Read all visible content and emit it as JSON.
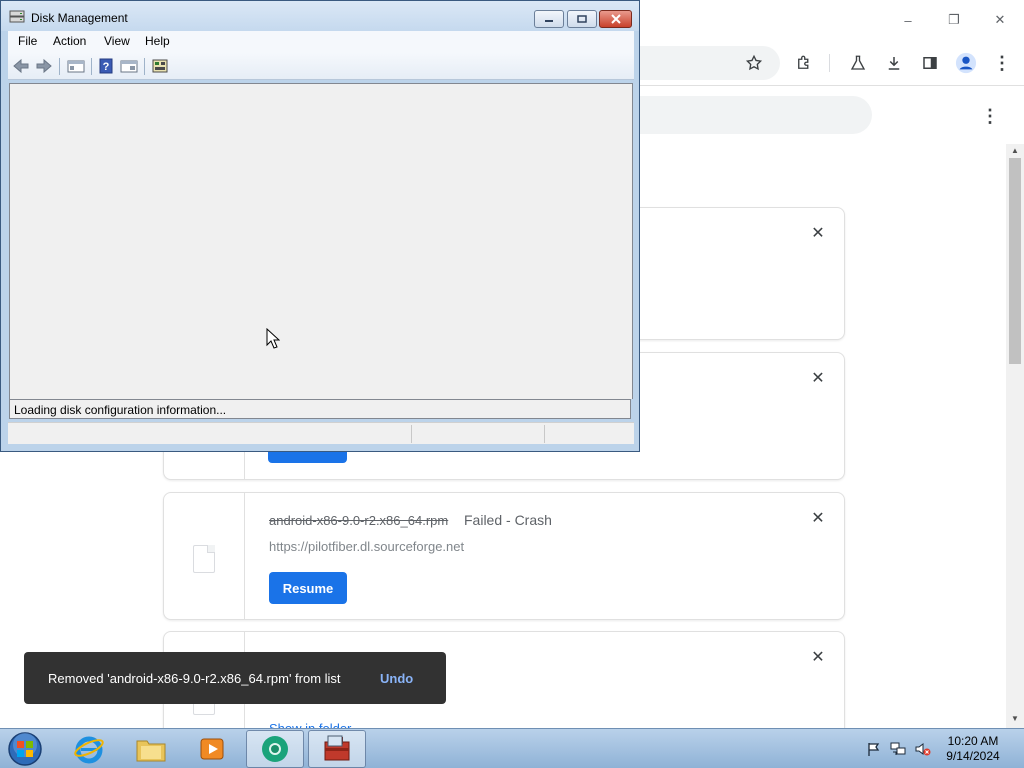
{
  "browser": {
    "window_controls": {
      "minimize": "–",
      "restore": "❐",
      "close": "✕"
    },
    "toolbar_icons": [
      "star-icon",
      "extensions-icon",
      "labs-icon",
      "download-icon",
      "side-panel-icon",
      "profile-icon",
      "menu-icon"
    ],
    "downloads": [
      {
        "file_name": "",
        "status": "",
        "url": "",
        "action": ""
      },
      {
        "file_name": "",
        "status": "",
        "url": "",
        "action": "Resume"
      },
      {
        "file_name": "android-x86-9.0-r2.x86_64.rpm",
        "status": "Failed - Crash",
        "url": "https://pilotfiber.dl.sourceforge.net",
        "action": "Resume"
      },
      {
        "file_name": "",
        "status": "",
        "url": "",
        "action": "Show in folder"
      }
    ],
    "toast": {
      "message": "Removed 'android-x86-9.0-r2.x86_64.rpm' from list",
      "undo": "Undo"
    }
  },
  "disk_management": {
    "title": "Disk Management",
    "menu": [
      "File",
      "Action",
      "View",
      "Help"
    ],
    "toolbar_icons": [
      "back-icon",
      "forward-icon",
      "console-tree-icon",
      "help-icon",
      "properties-icon",
      "disk-icon"
    ],
    "loading_text": "Loading disk configuration information..."
  },
  "taskbar": {
    "apps": [
      "start-orb",
      "internet-explorer",
      "file-explorer",
      "media-player",
      "chrome",
      "computer-management"
    ],
    "active_app": "computer-management",
    "clock": {
      "time": "10:20 AM",
      "date": "9/14/2024"
    }
  }
}
